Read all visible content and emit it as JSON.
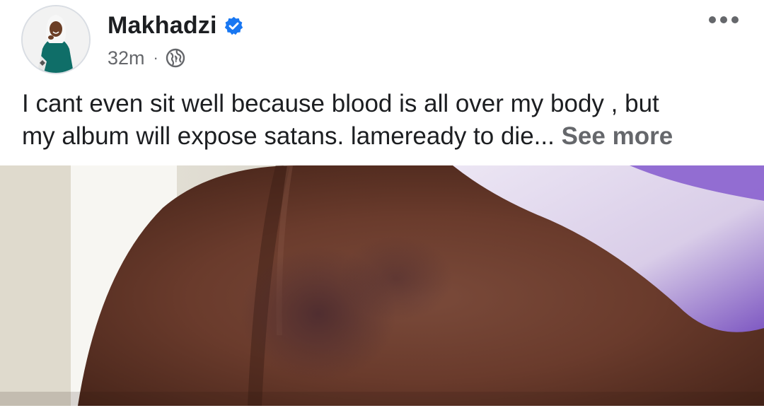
{
  "post": {
    "author_name": "Makhadzi",
    "verified_icon": "verified-badge-icon",
    "time_ago": "32m",
    "separator": "·",
    "audience_icon": "globe-icon",
    "menu_icon": "more-options-icon",
    "text_line1": "I cant even sit well because blood is all over my body , but",
    "text_line2": "my album will expose satans. lameready to die...",
    "see_more": "See more",
    "image_icon": "post-photo"
  },
  "colors": {
    "verified_blue": "#1877f2",
    "secondary_text": "#65676b",
    "primary_text": "#1c1e21"
  }
}
